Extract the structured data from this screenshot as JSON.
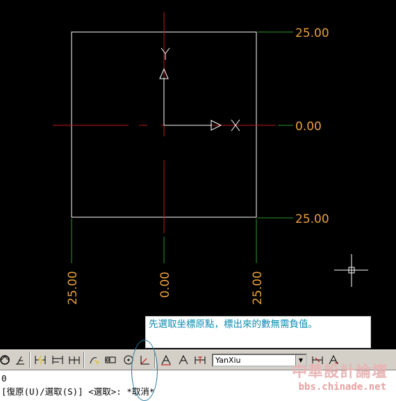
{
  "drawing": {
    "ordinate_labels": {
      "right_top": "25.00",
      "right_mid": "0.00",
      "right_bottom": "25.00",
      "bottom_left": "25.00",
      "bottom_mid": "0.00",
      "bottom_right": "25.00"
    },
    "ucs_axis_labels": {
      "x": "X",
      "y": "Y"
    },
    "colors": {
      "background": "#000000",
      "rectangle": "#ffffff",
      "centerline": "#c01818",
      "leader": "#2a9a2a",
      "ordinate_text": "#e8a040"
    }
  },
  "note": {
    "text": "先選取坐標原點，標出來的數無需負值。"
  },
  "toolbar": {
    "dimension_style": "YanXiu",
    "icons": [
      "dim-update-icon",
      "dim-oblique-icon",
      "dim-linear-icon",
      "dim-baseline-icon",
      "dim-continue-icon",
      "leader-icon",
      "tolerance-icon",
      "center-mark-icon",
      "ordinate-icon",
      "dim-edit-icon",
      "dim-text-edit-icon",
      "dim-override-icon",
      "dim-style-icon",
      "dim-style-apply-icon"
    ]
  },
  "command": {
    "line1": "0",
    "line2": "[復原(U)/選取(S)] <選取>: *取消*"
  },
  "watermark": {
    "title": "中華設計論壇",
    "url": "bbs.chinade.net"
  }
}
